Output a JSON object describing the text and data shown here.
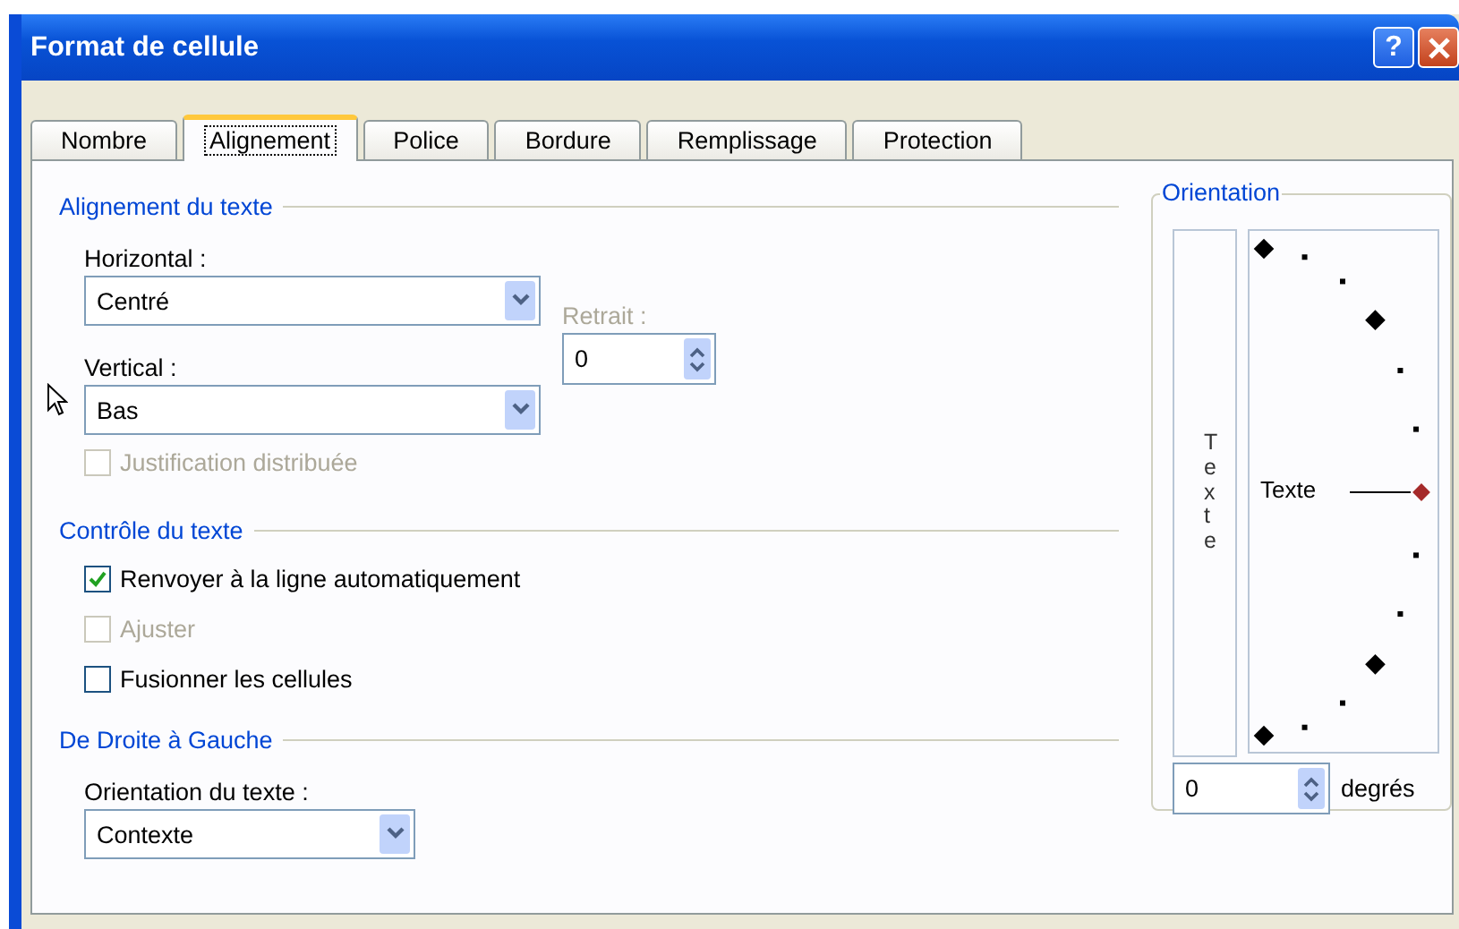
{
  "window": {
    "title": "Format de cellule",
    "help_label": "?"
  },
  "tabs": [
    {
      "label": "Nombre",
      "selected": false
    },
    {
      "label": "Alignement",
      "selected": true
    },
    {
      "label": "Police",
      "selected": false
    },
    {
      "label": "Bordure",
      "selected": false
    },
    {
      "label": "Remplissage",
      "selected": false
    },
    {
      "label": "Protection",
      "selected": false
    }
  ],
  "text_alignment": {
    "title": "Alignement du texte",
    "horizontal": {
      "label": "Horizontal :",
      "value": "Centré"
    },
    "indent": {
      "label": "Retrait :",
      "value": "0",
      "disabled": true
    },
    "vertical": {
      "label": "Vertical :",
      "value": "Bas"
    },
    "distributed": {
      "label": "Justification distribuée",
      "checked": false,
      "disabled": true
    }
  },
  "text_control": {
    "title": "Contrôle du texte",
    "options": [
      {
        "label": "Renvoyer à la ligne automatiquement",
        "checked": true,
        "disabled": false
      },
      {
        "label": "Ajuster",
        "checked": false,
        "disabled": true
      },
      {
        "label": "Fusionner les cellules",
        "checked": false,
        "disabled": false
      }
    ]
  },
  "right_to_left": {
    "title": "De Droite à Gauche",
    "direction": {
      "label": "Orientation du texte :",
      "value": "Contexte"
    }
  },
  "orientation": {
    "title": "Orientation",
    "vertical_text": "Texte",
    "dial_text": "Texte",
    "degrees": {
      "value": "0",
      "unit": "degrés"
    }
  }
}
